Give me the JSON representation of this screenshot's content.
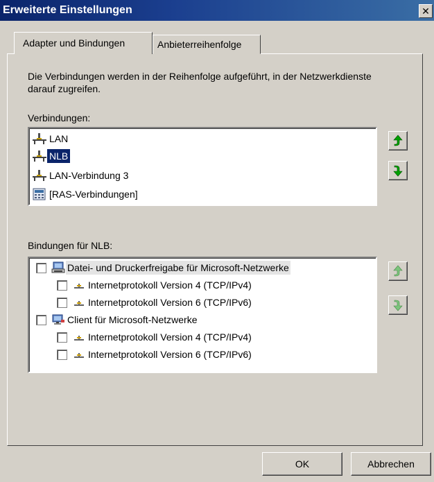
{
  "window": {
    "title": "Erweiterte Einstellungen",
    "close_glyph": "✕"
  },
  "tabs": [
    {
      "label": "Adapter und Bindungen",
      "active": true
    },
    {
      "label": "Anbieterreihenfolge",
      "active": false
    }
  ],
  "description": "Die Verbindungen werden in der Reihenfolge aufgeführt, in der Netzwerkdienste darauf zugreifen.",
  "connections": {
    "label": "Verbindungen:",
    "items": [
      {
        "label": "LAN",
        "icon": "network-adapter-icon",
        "selected": false
      },
      {
        "label": "NLB",
        "icon": "network-adapter-icon",
        "selected": true
      },
      {
        "label": "LAN-Verbindung 3",
        "icon": "network-adapter-icon",
        "selected": false
      },
      {
        "label": "[RAS-Verbindungen]",
        "icon": "ras-connections-icon",
        "selected": false
      }
    ]
  },
  "bindings": {
    "label": "Bindungen für NLB:",
    "items": [
      {
        "label": "Datei- und Druckerfreigabe für Microsoft-Netzwerke",
        "level": 0,
        "checked": false,
        "icon": "file-printer-sharing-icon"
      },
      {
        "label": "Internetprotokoll Version 4 (TCP/IPv4)",
        "level": 1,
        "checked": false,
        "icon": "protocol-icon"
      },
      {
        "label": "Internetprotokoll Version 6 (TCP/IPv6)",
        "level": 1,
        "checked": false,
        "icon": "protocol-icon"
      },
      {
        "label": "Client für Microsoft-Netzwerke",
        "level": 0,
        "checked": false,
        "icon": "network-client-icon"
      },
      {
        "label": "Internetprotokoll Version 4 (TCP/IPv4)",
        "level": 1,
        "checked": false,
        "icon": "protocol-icon"
      },
      {
        "label": "Internetprotokoll Version 6 (TCP/IPv6)",
        "level": 1,
        "checked": false,
        "icon": "protocol-icon"
      }
    ]
  },
  "buttons": {
    "ok": "OK",
    "cancel": "Abbrechen"
  },
  "colors": {
    "arrow_enabled": "#00a000",
    "arrow_disabled": "#7cc47c",
    "selection": "#0a246a",
    "titlebar": "#0a246a"
  }
}
